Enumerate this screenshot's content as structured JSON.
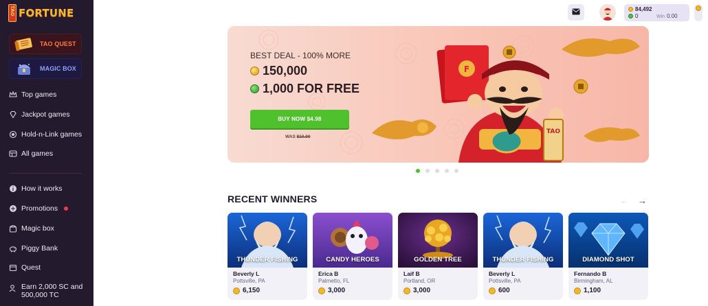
{
  "brand": {
    "badge": "TAO",
    "name": "FORTUNE"
  },
  "promos": [
    {
      "label": "TAO QUEST",
      "icon": "scroll-icon"
    },
    {
      "label": "MAGIC BOX",
      "icon": "treasure-chest-icon"
    }
  ],
  "nav_primary": [
    {
      "label": "Top games",
      "icon": "crown-icon"
    },
    {
      "label": "Jackpot games",
      "icon": "diamond-icon"
    },
    {
      "label": "Hold-n-Link games",
      "icon": "coin-stack-icon"
    },
    {
      "label": "All games",
      "icon": "grid-icon"
    }
  ],
  "nav_secondary": [
    {
      "label": "How it works",
      "icon": "info-icon"
    },
    {
      "label": "Promotions",
      "icon": "gift-icon",
      "badge": true
    },
    {
      "label": "Magic box",
      "icon": "box-icon"
    },
    {
      "label": "Piggy Bank",
      "icon": "piggy-bank-icon"
    },
    {
      "label": "Quest",
      "icon": "calendar-icon"
    }
  ],
  "nav_earn": {
    "line1": "Earn 2,000 SC and",
    "line2": "500,000 TC",
    "icon": "user-plus-icon"
  },
  "header": {
    "balance_primary": "84,492",
    "balance_secondary": "0",
    "win_label": "Win",
    "win_value": "0.00"
  },
  "banner": {
    "deal": "BEST DEAL - 100% MORE",
    "amount_gold": "150,000",
    "amount_green": "1,000 FOR FREE",
    "buy_label": "BUY NOW $4.98",
    "was_label": "WAS",
    "was_price": "$10.00",
    "statue_sign": "TAO"
  },
  "carousel": {
    "count": 5,
    "active": 0
  },
  "winners": {
    "title": "RECENT WINNERS",
    "cards": [
      {
        "game": "THUNDER FISHING",
        "name": "Beverly L",
        "location": "Pottsville, PA",
        "amount": "6,150",
        "theme": "thunder"
      },
      {
        "game": "CANDY HEROES",
        "name": "Erica B",
        "location": "Palmetto, FL",
        "amount": "3,000",
        "theme": "candy"
      },
      {
        "game": "GOLDEN TREE",
        "name": "Laif B",
        "location": "Portland, OR",
        "amount": "3,000",
        "theme": "tree"
      },
      {
        "game": "THUNDER FISHING",
        "name": "Beverly L",
        "location": "Pottsville, PA",
        "amount": "600",
        "theme": "thunder"
      },
      {
        "game": "DIAMOND SHOT",
        "name": "Fernando B",
        "location": "Birmingham, AL",
        "amount": "1,100",
        "theme": "diamond"
      }
    ]
  },
  "colors": {
    "sidebar": "#241a2e",
    "accent_green": "#4ec12c",
    "banner_pink": "#f9c5b6",
    "gold": "#f1b82a"
  }
}
